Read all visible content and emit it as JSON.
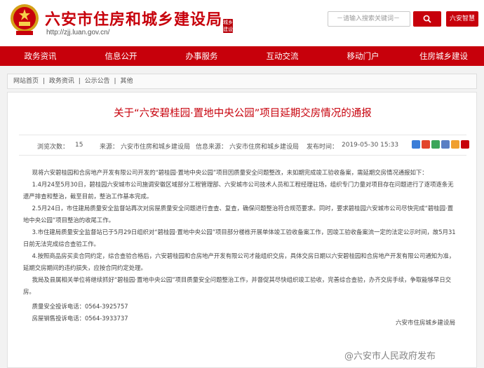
{
  "header": {
    "site_title": "六安市住房和城乡建设局",
    "site_url": "http://zjj.luan.gov.cn/",
    "seal_text": "城乡建设",
    "search_placeholder": "－请输入搜索关键词－",
    "region_button": "六安智慧"
  },
  "nav": {
    "items": [
      "政务资讯",
      "信息公开",
      "办事服务",
      "互动交流",
      "移动门户",
      "住房城乡建设"
    ]
  },
  "breadcrumb": {
    "items": [
      "网站首页",
      "政务资讯",
      "公示公告",
      "其他"
    ],
    "separator": "|"
  },
  "article": {
    "title": "关于“六安碧桂园·置地中央公园”项目延期交房情况的通报",
    "meta": {
      "views_label": "浏览次数：",
      "views_value": "15",
      "source_label": "来源：",
      "source_value": "六安市住房和城乡建设局",
      "info_source_label": "信息来源：",
      "info_source_value": "六安市住房和城乡建设局",
      "publish_label": "发布时间：",
      "publish_value": "2019-05-30 15:33"
    },
    "paragraphs": [
      "现将六安碧桂园和合房地产开发有限公司开发的“碧桂园·置地中央公园”项目因质量安全问题整改，未如期完成竣工验收备案，需延期交房情况通报如下：",
      "1.4月24至5月30日，碧桂园六安城市公司施调安徽区域部分工程管理部、六安城市公司技术人员和工程经理驻场，组织专门力量对项目存在问题进行了逐项逐条无遗严排查和整治，截至目前，整治工作基本完成。",
      "2.5月24日，市住建局质量安全监督站再次对房屋质量安全问题进行查查、复查，确保问题整治符合规范要求。同时，要求碧桂园六安城市公司尽快完成“碧桂园·置地中央公园”项目整治的收尾工作。",
      "3.市住建局质量安全监督站已于5月29日组织对“碧桂园·置地中央公园”项目部分楼栋开展单体竣工验收备案工作，因竣工验收备案流一定的法定公示时间，故5月31日前无法完成综合查验工作。",
      "4.按照商品房买卖合同约定，综合查验合格后，六安碧桂园和合房地产开发有限公司才能组织交房，具体交房日期以六安碧桂园和合房地产开发有限公司通知为准，延期交房期间的违约损失，应按合同约定处理。",
      "我局及县属相关单位将继续抓好“碧桂园·置地中央公园”项目质量安全问题整治工作，并督促其尽快组织竣工验收，完善综合查验，办齐交房手续，争取能够早日交房。"
    ],
    "phone_lines": [
      {
        "label": "质量安全投诉电话：",
        "value": "0564-3925757"
      },
      {
        "label": "房屋销售投诉电话：",
        "value": "0564-3933737"
      }
    ],
    "signature": "六安市住房城乡建设局",
    "watermark": "@六安市人民政府发布"
  },
  "colors": {
    "brand_red": "#c7000b"
  }
}
